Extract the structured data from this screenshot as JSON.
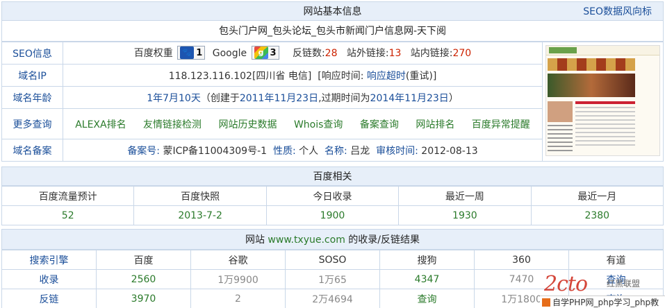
{
  "panel1": {
    "title": "网站基本信息",
    "seo_link": "SEO数据风向标",
    "site_name": "包头门户网_包头论坛_包头市新闻门户信息网-天下阅",
    "rows": {
      "seo": {
        "label": "SEO信息",
        "baidu_weight_label": "百度权重",
        "baidu_weight": "1",
        "google_label": "Google",
        "google_pr": "3",
        "backlinks_label": "反链数:",
        "backlinks": "28",
        "outbound_label": "站外链接:",
        "outbound": "13",
        "inbound_label": "站内链接:",
        "inbound": "270"
      },
      "ip": {
        "label": "域名IP",
        "value": "118.123.116.102[四川省 电信]",
        "resp_label": "[响应时间: ",
        "resp_value": "响应超时",
        "resp_suffix": "(重试)]"
      },
      "age": {
        "label": "域名年龄",
        "age": "1年7月10天",
        "created_prefix": "（创建于",
        "created": "2011年11月23日",
        "expire_prefix": ",过期时间为",
        "expire": "2014年11月23日",
        "suffix": "）"
      },
      "more": {
        "label": "更多查询",
        "links": [
          "ALEXA排名",
          "友情链接检测",
          "网站历史数据",
          "Whois查询",
          "备案查询",
          "网站排名",
          "百度异常提醒"
        ]
      },
      "icp": {
        "label": "域名备案",
        "no_label": "备案号: ",
        "no": "蒙ICP备11004309号-1",
        "type_label": "性质: ",
        "type": "个人",
        "name_label": "名称: ",
        "name": "吕龙",
        "date_label": "审核时间: ",
        "date": "2012-08-13"
      }
    }
  },
  "panel2": {
    "title": "百度相关",
    "headers": [
      "百度流量预计",
      "百度快照",
      "今日收录",
      "最近一周",
      "最近一月"
    ],
    "values": [
      "52",
      "2013-7-2",
      "1900",
      "1930",
      "2380"
    ]
  },
  "panel3": {
    "title_prefix": "网站 ",
    "domain": "www.txyue.com",
    "title_suffix": " 的收录/反链结果",
    "headers": [
      "搜索引擎",
      "百度",
      "谷歌",
      "SOSO",
      "搜狗",
      "360",
      "有道"
    ],
    "rows": [
      {
        "label": "收录",
        "values": [
          "2560",
          "1万9900",
          "1万65",
          "4347",
          "7470",
          "查询"
        ]
      },
      {
        "label": "反链",
        "values": [
          "3970",
          "2",
          "2万4694",
          "查询",
          "1万1800",
          "查询"
        ]
      }
    ]
  },
  "watermark": {
    "logo": "2cto",
    "tag": "红黑联盟",
    "bar": "自学PHP网_php学习_php教程"
  },
  "colors": {
    "header_bg": "#e7eff9",
    "border": "#c9d7e8",
    "link_blue": "#1a4e99",
    "green": "#2a7a2a",
    "red": "#cc2200"
  }
}
